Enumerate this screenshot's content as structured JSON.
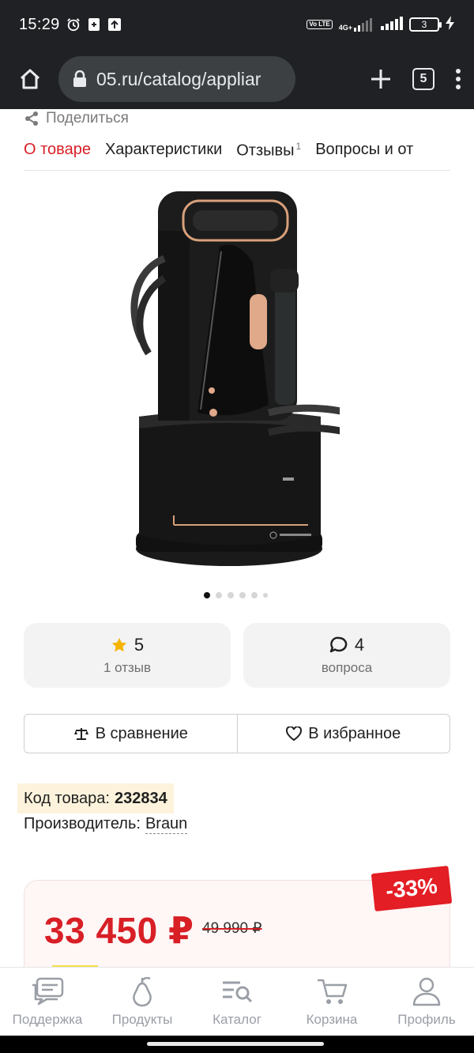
{
  "status_bar": {
    "time": "15:29",
    "network": "4G+",
    "volte": "Vo LTE",
    "battery": "3"
  },
  "browser": {
    "url": "05.ru/catalog/appliar",
    "tab_count": "5"
  },
  "share": {
    "label": "Поделиться"
  },
  "tabs": [
    {
      "label": "О товаре",
      "active": true
    },
    {
      "label": "Характеристики"
    },
    {
      "label": "Отзывы",
      "count": "1"
    },
    {
      "label": "Вопросы и от"
    }
  ],
  "gallery": {
    "image_count": 6,
    "active_index": 0
  },
  "rating_card": {
    "value": "5",
    "sub": "1 отзыв"
  },
  "questions_card": {
    "value": "4",
    "sub": "вопроса"
  },
  "actions": {
    "compare_label": "В сравнение",
    "favorite_label": "В избранное"
  },
  "product_info": {
    "code_label": "Код товара:",
    "code_value": "232834",
    "maker_label": "Производитель:",
    "maker_value": "Braun"
  },
  "price": {
    "current": "33 450 ₽",
    "old": "49 990 ₽",
    "discount": "-33%"
  },
  "bottom_nav": [
    {
      "label": "Поддержка",
      "icon": "chat-icon"
    },
    {
      "label": "Продукты",
      "icon": "pear-icon"
    },
    {
      "label": "Каталог",
      "icon": "catalog-search-icon"
    },
    {
      "label": "Корзина",
      "icon": "cart-icon"
    },
    {
      "label": "Профиль",
      "icon": "profile-icon"
    }
  ],
  "colors": {
    "accent_red": "#d81f26",
    "badge_red": "#e31e24",
    "star_yellow": "#f5b400",
    "nav_gray": "#9a9ea6"
  }
}
